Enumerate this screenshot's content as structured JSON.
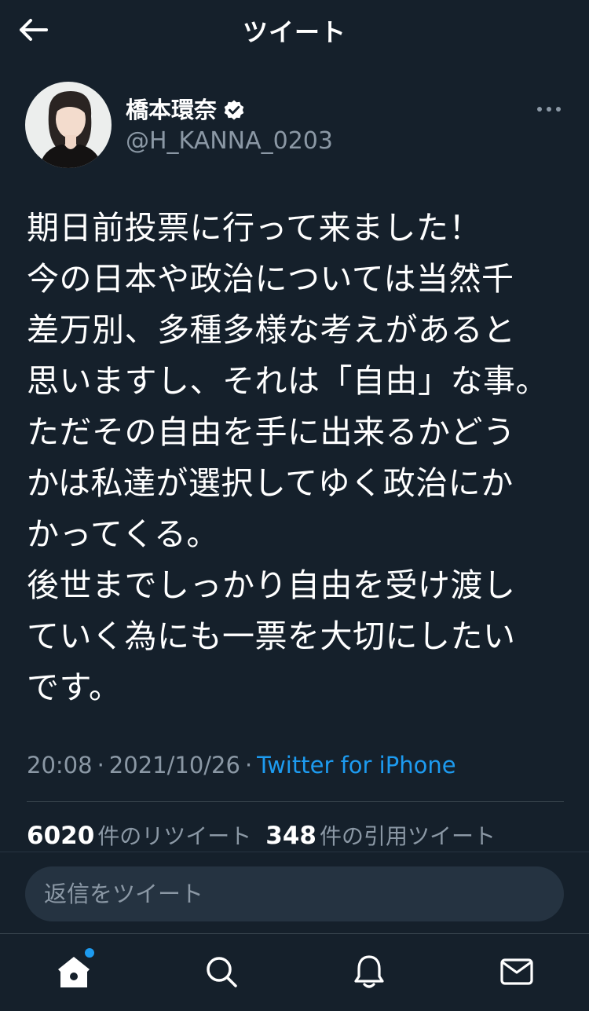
{
  "header": {
    "title": "ツイート",
    "back_icon": "arrow-left-icon"
  },
  "author": {
    "display_name": "橋本環奈",
    "handle": "@H_KANNA_0203",
    "verified": true,
    "verified_icon": "verified-badge-icon",
    "more_icon": "more-horizontal-icon"
  },
  "tweet": {
    "lines": [
      "期日前投票に行って来ました！",
      "今の日本や政治については当然千",
      "差万別、多種多様な考えがあると",
      "思いますし、それは「自由」な事。",
      "ただその自由を手に出来るかどう",
      "かは私達が選択してゆく政治にか",
      "かってくる。",
      "後世までしっかり自由を受け渡し",
      "ていく為にも一票を大切にしたい",
      "です。"
    ],
    "time": "20:08",
    "date": "2021/10/26",
    "separator": "·",
    "source": "Twitter for iPhone"
  },
  "stats": {
    "retweets_count": "6020",
    "retweets_label": "件のリツイート",
    "quotes_count": "348",
    "quotes_label": "件の引用ツイート"
  },
  "reply": {
    "placeholder": "返信をツイート"
  },
  "tabbar": {
    "items": [
      {
        "icon": "home-icon",
        "has_notification": true
      },
      {
        "icon": "search-icon",
        "has_notification": false
      },
      {
        "icon": "bell-icon",
        "has_notification": false
      },
      {
        "icon": "mail-icon",
        "has_notification": false
      }
    ]
  },
  "colors": {
    "background": "#15202b",
    "accent": "#1d9bf0",
    "secondary_text": "#8b98a5",
    "divider": "#38444d"
  }
}
